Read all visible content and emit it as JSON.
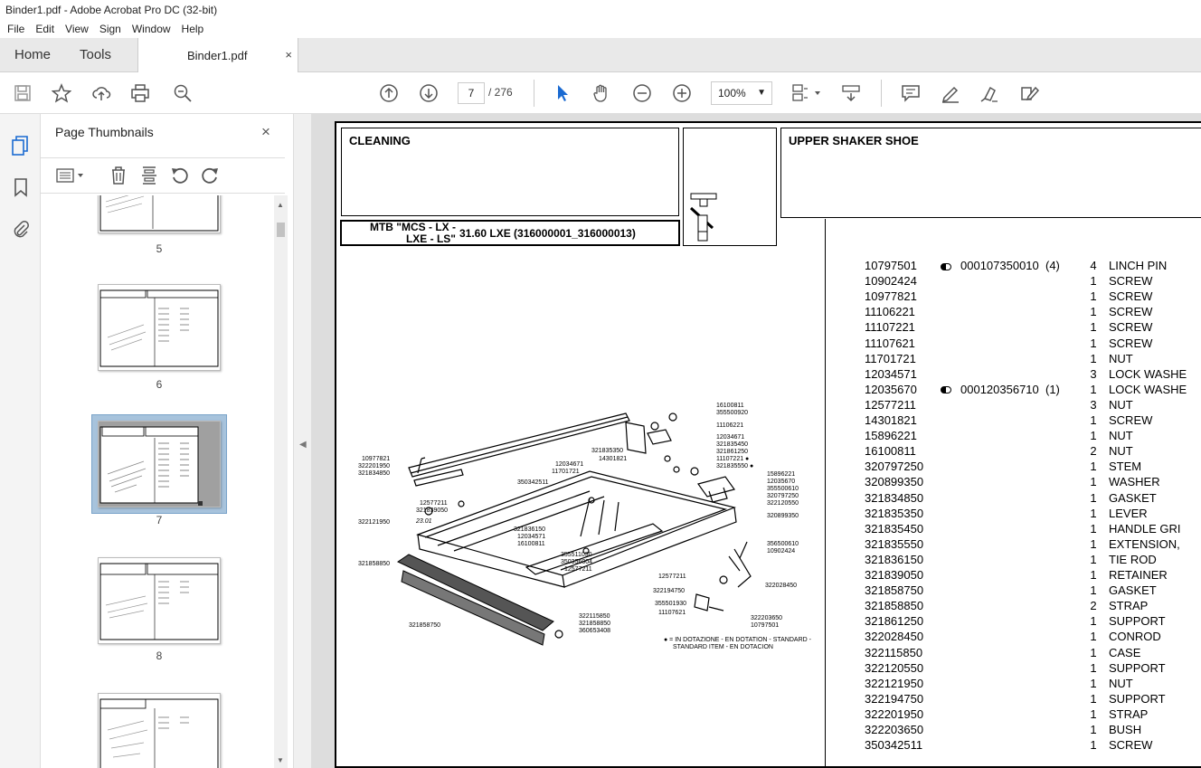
{
  "window": {
    "title": "Binder1.pdf - Adobe Acrobat Pro DC (32-bit)"
  },
  "menu": [
    "File",
    "Edit",
    "View",
    "Sign",
    "Window",
    "Help"
  ],
  "tabs": {
    "home": "Home",
    "tools": "Tools",
    "document": "Binder1.pdf",
    "close_glyph": "×"
  },
  "toolbar": {
    "current_page": "7",
    "page_total": "/ 276",
    "zoom": "100%"
  },
  "thumbnails": {
    "title": "Page Thumbnails",
    "pages": [
      "5",
      "6",
      "7",
      "8"
    ],
    "selected": "7"
  },
  "document": {
    "section": "CLEANING",
    "title": "UPPER SHAKER SHOE",
    "model_line1": "MTB \"MCS - LX -",
    "model_line2": "LXE - LS\"",
    "model_code": "31.60 LXE (316000001_316000013)",
    "legend_line1": "● = IN DOTAZIONE - EN DOTATION - STANDARD -",
    "legend_line2": "STANDARD ITEM - EN DOTACION",
    "diagram_dimension": "23.01",
    "parts": [
      {
        "code": "10797501",
        "ref": "000107350010  (4)",
        "qty": "4",
        "desc": "LINCH PIN"
      },
      {
        "code": "10902424",
        "ref": "",
        "qty": "1",
        "desc": "SCREW"
      },
      {
        "code": "10977821",
        "ref": "",
        "qty": "1",
        "desc": "SCREW"
      },
      {
        "code": "11106221",
        "ref": "",
        "qty": "1",
        "desc": "SCREW"
      },
      {
        "code": "11107221",
        "ref": "",
        "qty": "1",
        "desc": "SCREW"
      },
      {
        "code": "11107621",
        "ref": "",
        "qty": "1",
        "desc": "SCREW"
      },
      {
        "code": "11701721",
        "ref": "",
        "qty": "1",
        "desc": "NUT"
      },
      {
        "code": "12034571",
        "ref": "",
        "qty": "3",
        "desc": "LOCK WASHE"
      },
      {
        "code": "12035670",
        "ref": "000120356710  (1)",
        "qty": "1",
        "desc": "LOCK WASHE"
      },
      {
        "code": "12577211",
        "ref": "",
        "qty": "3",
        "desc": "NUT"
      },
      {
        "code": "14301821",
        "ref": "",
        "qty": "1",
        "desc": "SCREW"
      },
      {
        "code": "15896221",
        "ref": "",
        "qty": "1",
        "desc": "NUT"
      },
      {
        "code": "16100811",
        "ref": "",
        "qty": "2",
        "desc": "NUT"
      },
      {
        "code": "320797250",
        "ref": "",
        "qty": "1",
        "desc": "STEM"
      },
      {
        "code": "320899350",
        "ref": "",
        "qty": "1",
        "desc": "WASHER"
      },
      {
        "code": "321834850",
        "ref": "",
        "qty": "1",
        "desc": "GASKET"
      },
      {
        "code": "321835350",
        "ref": "",
        "qty": "1",
        "desc": "LEVER"
      },
      {
        "code": "321835450",
        "ref": "",
        "qty": "1",
        "desc": "HANDLE GRI"
      },
      {
        "code": "321835550",
        "ref": "",
        "qty": "1",
        "desc": "EXTENSION,"
      },
      {
        "code": "321836150",
        "ref": "",
        "qty": "1",
        "desc": "TIE ROD"
      },
      {
        "code": "321839050",
        "ref": "",
        "qty": "1",
        "desc": "RETAINER"
      },
      {
        "code": "321858750",
        "ref": "",
        "qty": "1",
        "desc": "GASKET"
      },
      {
        "code": "321858850",
        "ref": "",
        "qty": "2",
        "desc": "STRAP"
      },
      {
        "code": "321861250",
        "ref": "",
        "qty": "1",
        "desc": "SUPPORT"
      },
      {
        "code": "322028450",
        "ref": "",
        "qty": "1",
        "desc": "CONROD"
      },
      {
        "code": "322115850",
        "ref": "",
        "qty": "1",
        "desc": "CASE"
      },
      {
        "code": "322120550",
        "ref": "",
        "qty": "1",
        "desc": "SUPPORT"
      },
      {
        "code": "322121950",
        "ref": "",
        "qty": "1",
        "desc": "NUT"
      },
      {
        "code": "322194750",
        "ref": "",
        "qty": "1",
        "desc": "SUPPORT"
      },
      {
        "code": "322201950",
        "ref": "",
        "qty": "1",
        "desc": "STRAP"
      },
      {
        "code": "322203650",
        "ref": "",
        "qty": "1",
        "desc": "BUSH"
      },
      {
        "code": "350342511",
        "ref": "",
        "qty": "1",
        "desc": "SCREW"
      }
    ],
    "diagram_labels": [
      "16100811",
      "355500920",
      "11106221",
      "12034671",
      "321835450",
      "321835350",
      "14301821",
      "321861250",
      "11107221 ●",
      "321835550 ●",
      "15896221",
      "12035670",
      "355500610",
      "320797250",
      "322120550",
      "320899350",
      "10977821",
      "322201950",
      "321834850",
      "12034671",
      "11701721",
      "350342511",
      "12577211",
      "321839050",
      "322121950",
      "321836150",
      "12034571",
      "16100811",
      "355511030",
      "350356004",
      "12577211",
      "321858850",
      "356500610",
      "10902424",
      "12577211",
      "322194750",
      "355501930",
      "11107621",
      "322028450",
      "322203650",
      "10797501",
      "322115850",
      "321858850",
      "360653408",
      "321858750"
    ]
  }
}
